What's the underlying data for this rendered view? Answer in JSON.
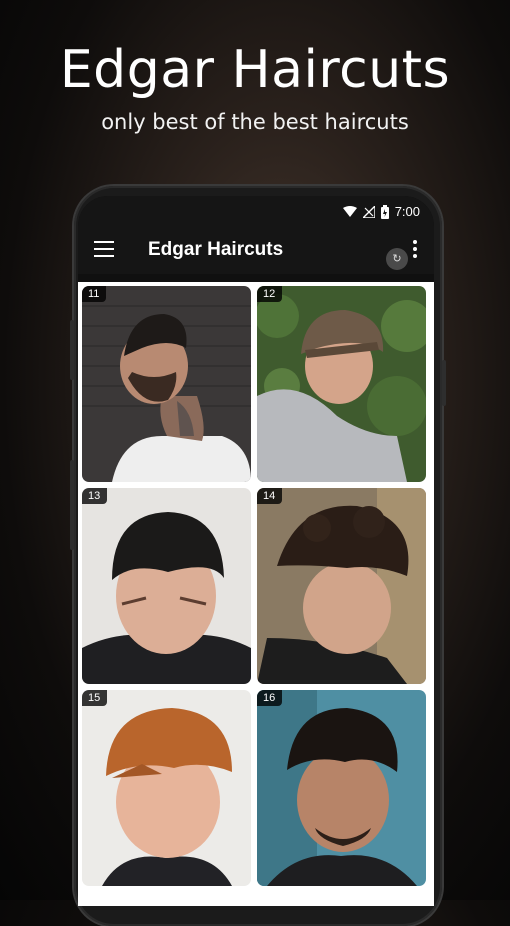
{
  "promo": {
    "title": "Edgar Haircuts",
    "subtitle": "only best of the best haircuts"
  },
  "status_bar": {
    "time": "7:00",
    "icons": [
      "wifi-icon",
      "signal-icon",
      "battery-icon"
    ]
  },
  "app_bar": {
    "title": "Edgar Haircuts",
    "menu_icon": "hamburger-menu-icon",
    "overflow_icon": "more-vert-icon"
  },
  "gallery": {
    "items": [
      {
        "number": "11"
      },
      {
        "number": "12"
      },
      {
        "number": "13"
      },
      {
        "number": "14"
      },
      {
        "number": "15"
      },
      {
        "number": "16"
      }
    ]
  },
  "colors": {
    "app_bar": "#151515",
    "grid_background": "#ffffff",
    "badge_background": "#000000"
  }
}
